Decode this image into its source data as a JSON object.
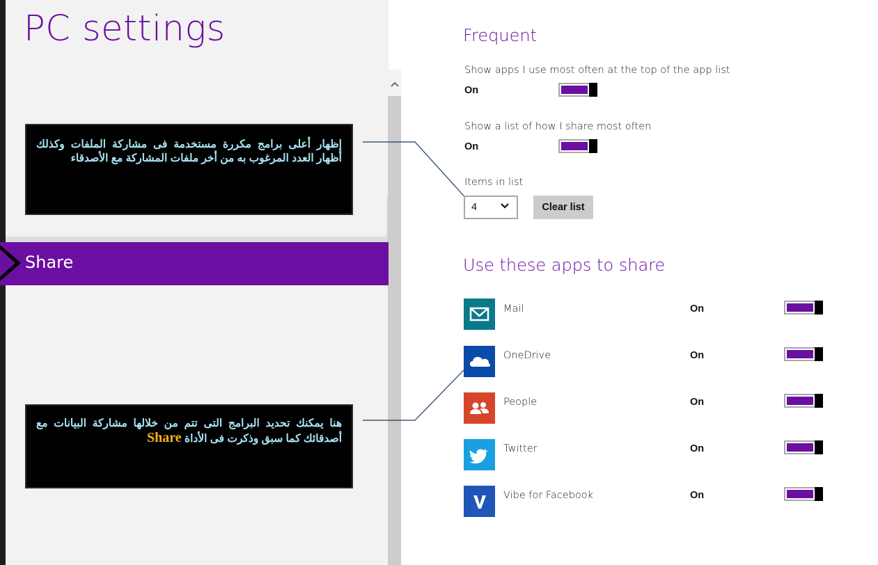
{
  "left_panel": {
    "title": "PC settings",
    "selected_item": "Share",
    "callout_top": "إظهار أعلى برامج مكررة مستخدمة فى مشاركة الملفات وكذلك أظهار العدد المرغوب به من أخر ملفات المشاركة مع الأصدقاء",
    "callout_bottom_text": "هنا يمكنك تحديد البرامج التى تتم من خلالها مشاركة البيانات مع أصدقائك كما سبق وذكرت فى الأداة",
    "callout_bottom_highlight": "Share"
  },
  "frequent": {
    "heading": "Frequent",
    "setting1_label": "Show apps I use most often at the top of the app list",
    "setting1_state": "On",
    "setting2_label": "Show a list of how I share most often",
    "setting2_state": "On",
    "items_label": "Items in list",
    "items_value": "4",
    "clear_button": "Clear list"
  },
  "apps_section": {
    "heading": "Use these apps to share",
    "apps": [
      {
        "name": "Mail",
        "state": "On",
        "color": "#0a7a8a",
        "icon": "mail-icon"
      },
      {
        "name": "OneDrive",
        "state": "On",
        "color": "#0a4aa8",
        "icon": "cloud-icon"
      },
      {
        "name": "People",
        "state": "On",
        "color": "#d8452a",
        "icon": "people-icon"
      },
      {
        "name": "Twitter",
        "state": "On",
        "color": "#1aa0e0",
        "icon": "bird-icon"
      },
      {
        "name": "Vibe for Facebook",
        "state": "On",
        "color": "#1f56b8",
        "icon": "v-letter-icon"
      }
    ]
  },
  "colors": {
    "accent": "#6b0fa2",
    "callout_text": "#a9e4f4",
    "callout_highlight": "#f7b21a"
  }
}
